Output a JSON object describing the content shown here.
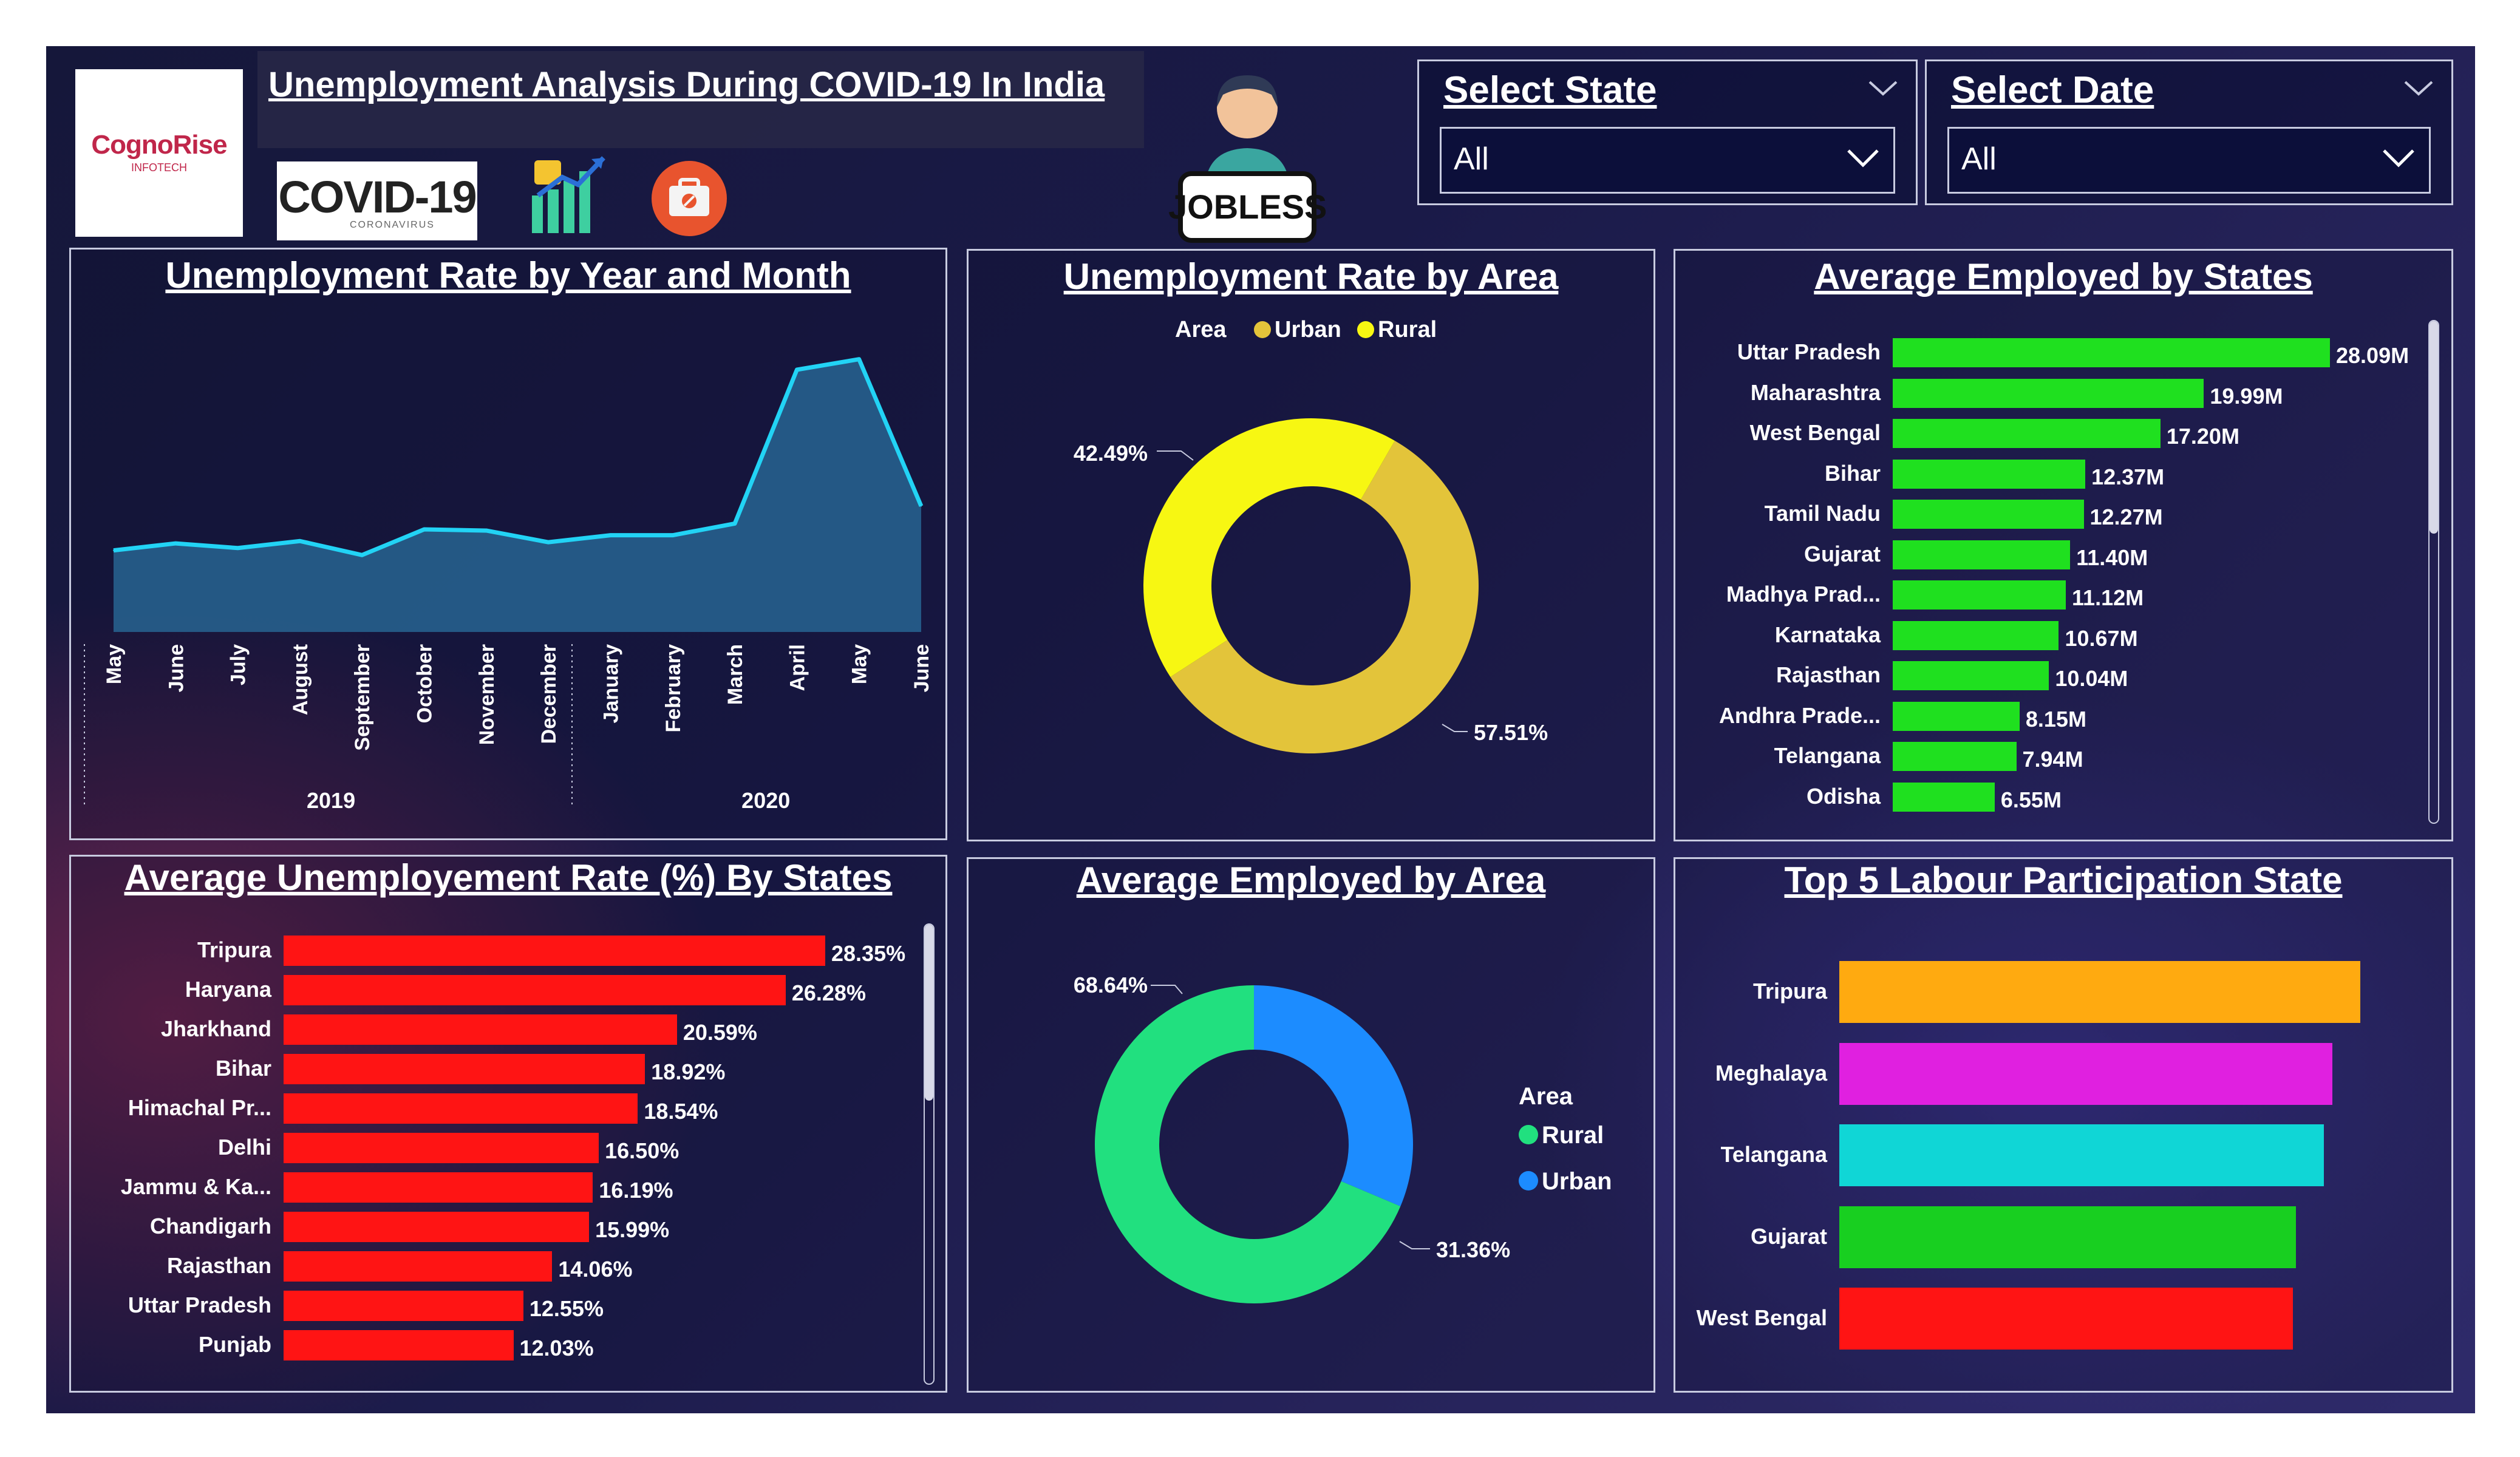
{
  "header": {
    "title": "Unemployment Analysis During COVID-19 In India",
    "logo_brand": "CognoRise",
    "logo_sub": "INFOTECH",
    "covid_logo": "COVID-19",
    "covid_sub": "CORONAVIRUS",
    "jobless_label": "JOBLESS"
  },
  "slicers": {
    "state": {
      "title": "Select State",
      "value": "All"
    },
    "date": {
      "title": "Select Date",
      "value": "All"
    }
  },
  "panels": {
    "line": {
      "title": "Unemployment Rate by Year and Month"
    },
    "area_donut": {
      "title": "Unemployment Rate by Area"
    },
    "employed_states": {
      "title": "Average Employed by States"
    },
    "unemp_states": {
      "title": "Average Unemployement Rate (%) By States"
    },
    "employed_area": {
      "title": "Average Employed by Area"
    },
    "labour": {
      "title": "Top 5 Labour Participation State"
    }
  },
  "colors": {
    "line_stroke": "#22d3f5",
    "line_fill": "#2a6f9e",
    "urban": "#e3c43a",
    "rural_yellow": "#f7f712",
    "employed_bar": "#1fe01f",
    "unemp_bar": "#ff1414",
    "rural_green": "#21e07f",
    "urban_blue": "#1c8cff"
  },
  "chart_data": [
    {
      "type": "area",
      "title": "Unemployment Rate by Year and Month",
      "categories": [
        "May",
        "June",
        "July",
        "August",
        "September",
        "October",
        "November",
        "December",
        "January",
        "February",
        "March",
        "April",
        "May",
        "June"
      ],
      "years": [
        {
          "label": "2019",
          "span": [
            0,
            7
          ]
        },
        {
          "label": "2020",
          "span": [
            8,
            13
          ]
        }
      ],
      "values": [
        7.0,
        7.6,
        7.2,
        7.8,
        6.6,
        8.8,
        8.7,
        7.7,
        8.3,
        8.3,
        9.3,
        22.5,
        23.4,
        10.8
      ],
      "ylim": [
        0,
        25
      ]
    },
    {
      "type": "pie",
      "title": "Unemployment Rate by Area",
      "legend_title": "Area",
      "labels": [
        "Urban",
        "Rural"
      ],
      "values": [
        57.51,
        42.49
      ],
      "value_labels": [
        "57.51%",
        "42.49%"
      ],
      "colors": [
        "#e3c43a",
        "#f7f712"
      ]
    },
    {
      "type": "bar",
      "title": "Average Employed by States",
      "categories": [
        "Uttar Pradesh",
        "Maharashtra",
        "West Bengal",
        "Bihar",
        "Tamil Nadu",
        "Gujarat",
        "Madhya Prad...",
        "Karnataka",
        "Rajasthan",
        "Andhra Prade...",
        "Telangana",
        "Odisha"
      ],
      "values": [
        28.09,
        19.99,
        17.2,
        12.37,
        12.27,
        11.4,
        11.12,
        10.67,
        10.04,
        8.15,
        7.94,
        6.55
      ],
      "value_labels": [
        "28.09M",
        "19.99M",
        "17.20M",
        "12.37M",
        "12.27M",
        "11.40M",
        "11.12M",
        "10.67M",
        "10.04M",
        "8.15M",
        "7.94M",
        "6.55M"
      ]
    },
    {
      "type": "bar",
      "title": "Average Unemployement Rate (%) By States",
      "categories": [
        "Tripura",
        "Haryana",
        "Jharkhand",
        "Bihar",
        "Himachal Pr...",
        "Delhi",
        "Jammu & Ka...",
        "Chandigarh",
        "Rajasthan",
        "Uttar Pradesh",
        "Punjab"
      ],
      "values": [
        28.35,
        26.28,
        20.59,
        18.92,
        18.54,
        16.5,
        16.19,
        15.99,
        14.06,
        12.55,
        12.03
      ],
      "value_labels": [
        "28.35%",
        "26.28%",
        "20.59%",
        "18.92%",
        "18.54%",
        "16.50%",
        "16.19%",
        "15.99%",
        "14.06%",
        "12.55%",
        "12.03%"
      ]
    },
    {
      "type": "pie",
      "title": "Average Employed by Area",
      "legend_title": "Area",
      "labels": [
        "Rural",
        "Urban"
      ],
      "values": [
        68.64,
        31.36
      ],
      "value_labels": [
        "68.64%",
        "31.36%"
      ],
      "colors": [
        "#21e07f",
        "#1c8cff"
      ]
    },
    {
      "type": "bar",
      "title": "Top 5 Labour Participation State",
      "categories": [
        "Tripura",
        "Meghalaya",
        "Telangana",
        "Gujarat",
        "West Bengal"
      ],
      "values": [
        61.8,
        58.5,
        57.5,
        54.2,
        53.8
      ],
      "colors": [
        "#ffaa10",
        "#e020e0",
        "#10d6d6",
        "#18cf20",
        "#ff1414"
      ]
    }
  ]
}
